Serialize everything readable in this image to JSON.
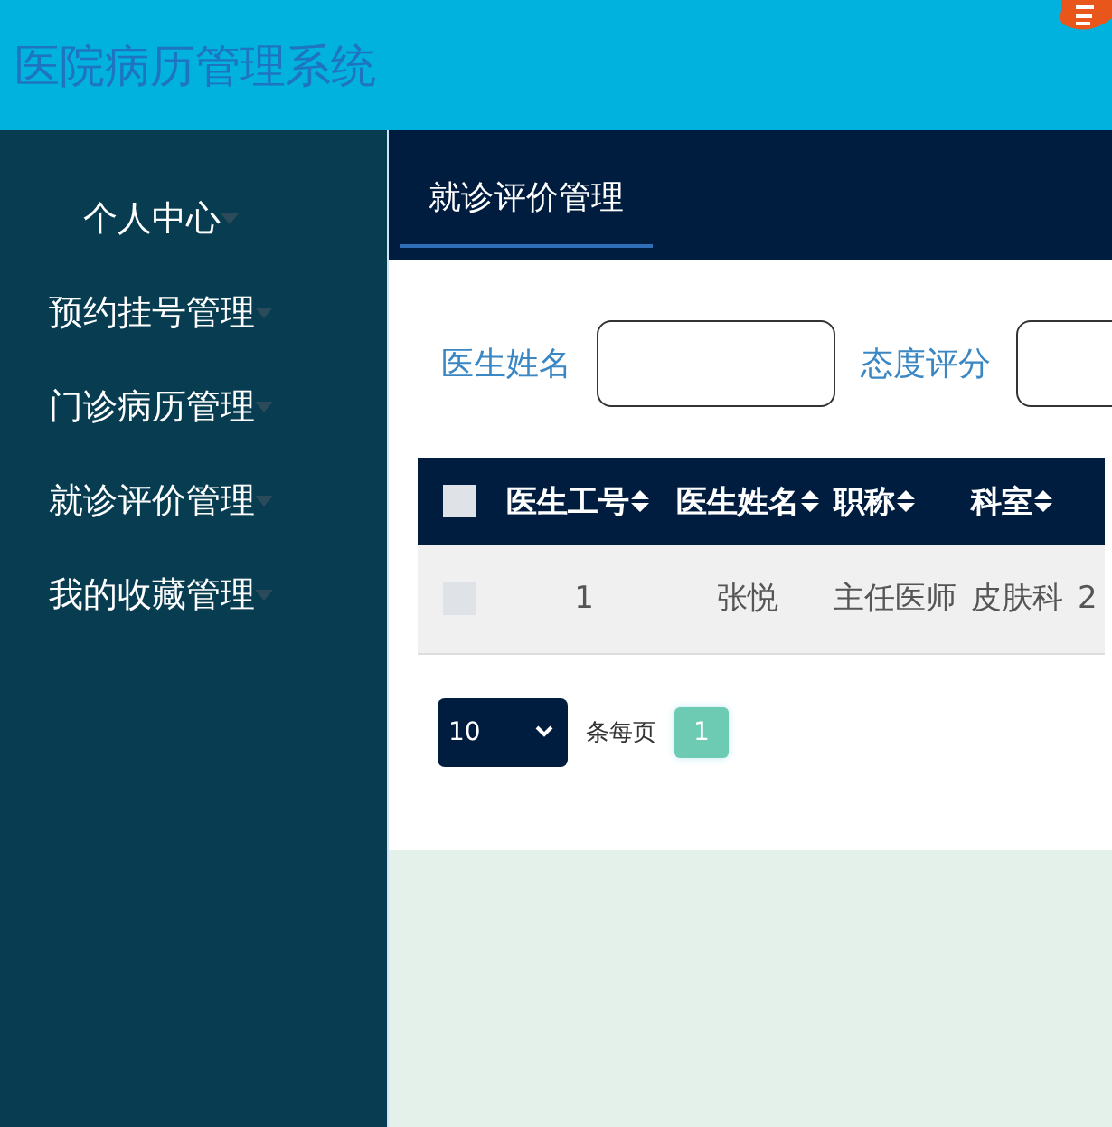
{
  "header": {
    "title": "医院病历管理系统"
  },
  "sidebar": {
    "items": [
      {
        "label": "个人中心",
        "expanded": false
      },
      {
        "label": "预约挂号管理",
        "expanded": false
      },
      {
        "label": "门诊病历管理",
        "expanded": false
      },
      {
        "label": "就诊评价管理",
        "expanded": false
      },
      {
        "label": "我的收藏管理",
        "expanded": false
      }
    ]
  },
  "tabs": [
    {
      "label": "就诊评价管理",
      "selected": true
    }
  ],
  "filters": [
    {
      "label": "医生姓名"
    },
    {
      "label": "态度评分"
    }
  ],
  "table": {
    "select_all": {
      "checked": false
    },
    "columns": [
      {
        "label": "医生工号"
      },
      {
        "label": "医生姓名"
      },
      {
        "label": "职称"
      },
      {
        "label": "科室"
      }
    ],
    "rows": [
      {
        "checked": false,
        "cells": [
          "1",
          "张悦",
          "主任医师",
          "皮肤科",
          "2"
        ]
      }
    ]
  },
  "pagination": {
    "page_size": "10",
    "per_page_label": "条每页",
    "pages": [
      {
        "label": "1",
        "selected": true
      }
    ]
  }
}
